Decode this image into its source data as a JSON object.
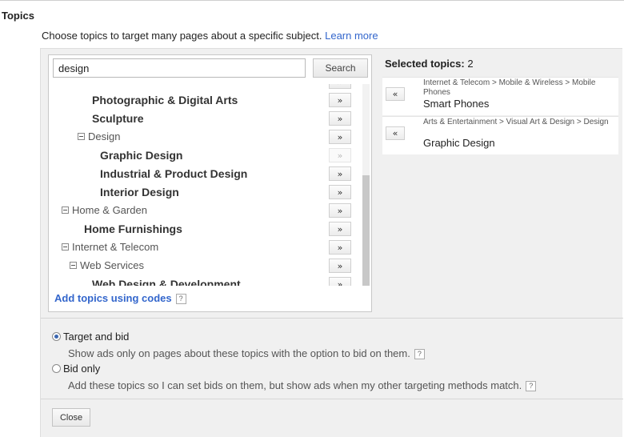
{
  "header": {
    "title": "Topics",
    "description": "Choose topics to target many pages about a specific subject.",
    "learn_more": "Learn more"
  },
  "search": {
    "value": "design",
    "button_label": "Search"
  },
  "tree": {
    "rows": [
      {
        "label": "Photographic & Digital Arts",
        "style": "bold",
        "expander": false,
        "add_enabled": true
      },
      {
        "label": "Sculpture",
        "style": "bold",
        "expander": false,
        "add_enabled": true
      },
      {
        "label": "Design",
        "style": "plain",
        "expander": true,
        "add_enabled": true
      },
      {
        "label": "Graphic Design",
        "style": "bold",
        "expander": false,
        "add_enabled": false
      },
      {
        "label": "Industrial & Product Design",
        "style": "bold",
        "expander": false,
        "add_enabled": true
      },
      {
        "label": "Interior Design",
        "style": "bold",
        "expander": false,
        "add_enabled": true
      },
      {
        "label": "Home & Garden",
        "style": "plain",
        "expander": true,
        "add_enabled": true
      },
      {
        "label": "Home Furnishings",
        "style": "bold",
        "expander": false,
        "add_enabled": true
      },
      {
        "label": "Internet & Telecom",
        "style": "plain",
        "expander": true,
        "add_enabled": true
      },
      {
        "label": "Web Services",
        "style": "plain",
        "expander": true,
        "add_enabled": true
      },
      {
        "label": "Web Design & Development",
        "style": "bold",
        "expander": false,
        "add_enabled": true
      }
    ],
    "add_symbol": "»",
    "add_codes_label": "Add topics using codes",
    "help_symbol": "?"
  },
  "selected": {
    "title": "Selected topics",
    "count": "2",
    "remove_symbol": "«",
    "items": [
      {
        "path": "Internet & Telecom > Mobile & Wireless > Mobile Phones",
        "name": "Smart Phones"
      },
      {
        "path": "Arts & Entertainment > Visual Art & Design > Design",
        "name": "Graphic Design"
      }
    ]
  },
  "options": {
    "target_and_bid": {
      "label": "Target and bid",
      "description": "Show ads only on pages about these topics with the option to bid on them.",
      "checked": true
    },
    "bid_only": {
      "label": "Bid only",
      "description": "Add these topics so I can set bids on them, but show ads when my other targeting methods match.",
      "checked": false
    }
  },
  "footer": {
    "close_label": "Close"
  },
  "colors": {
    "link": "#3366cc",
    "panel_bg": "#f0f0f0"
  }
}
